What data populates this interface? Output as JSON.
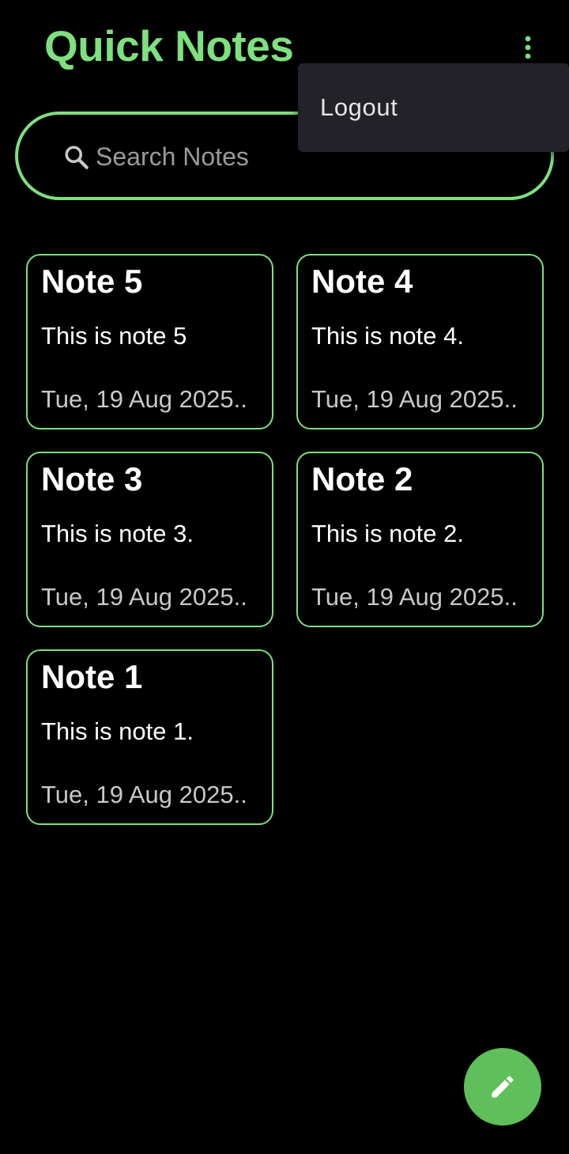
{
  "app": {
    "title": "Quick Notes",
    "accent_color": "#7ee07e",
    "fab_color": "#5fbf5a"
  },
  "header": {
    "overflow_icon": "more-vert-icon"
  },
  "search": {
    "placeholder": "Search Notes",
    "icon": "search-icon"
  },
  "menu": {
    "items": [
      {
        "label": "Logout"
      }
    ]
  },
  "notes": [
    {
      "title": "Note 5",
      "body": "This is note 5",
      "date": "Tue, 19 Aug 2025.."
    },
    {
      "title": "Note 4",
      "body": "This is note 4.",
      "date": "Tue, 19 Aug 2025.."
    },
    {
      "title": "Note 3",
      "body": "This is note 3.",
      "date": "Tue, 19 Aug 2025.."
    },
    {
      "title": "Note 2",
      "body": "This is note 2.",
      "date": "Tue, 19 Aug 2025.."
    },
    {
      "title": "Note 1",
      "body": "This is note 1.",
      "date": "Tue, 19 Aug 2025.."
    }
  ],
  "fab": {
    "icon": "pencil-icon"
  }
}
